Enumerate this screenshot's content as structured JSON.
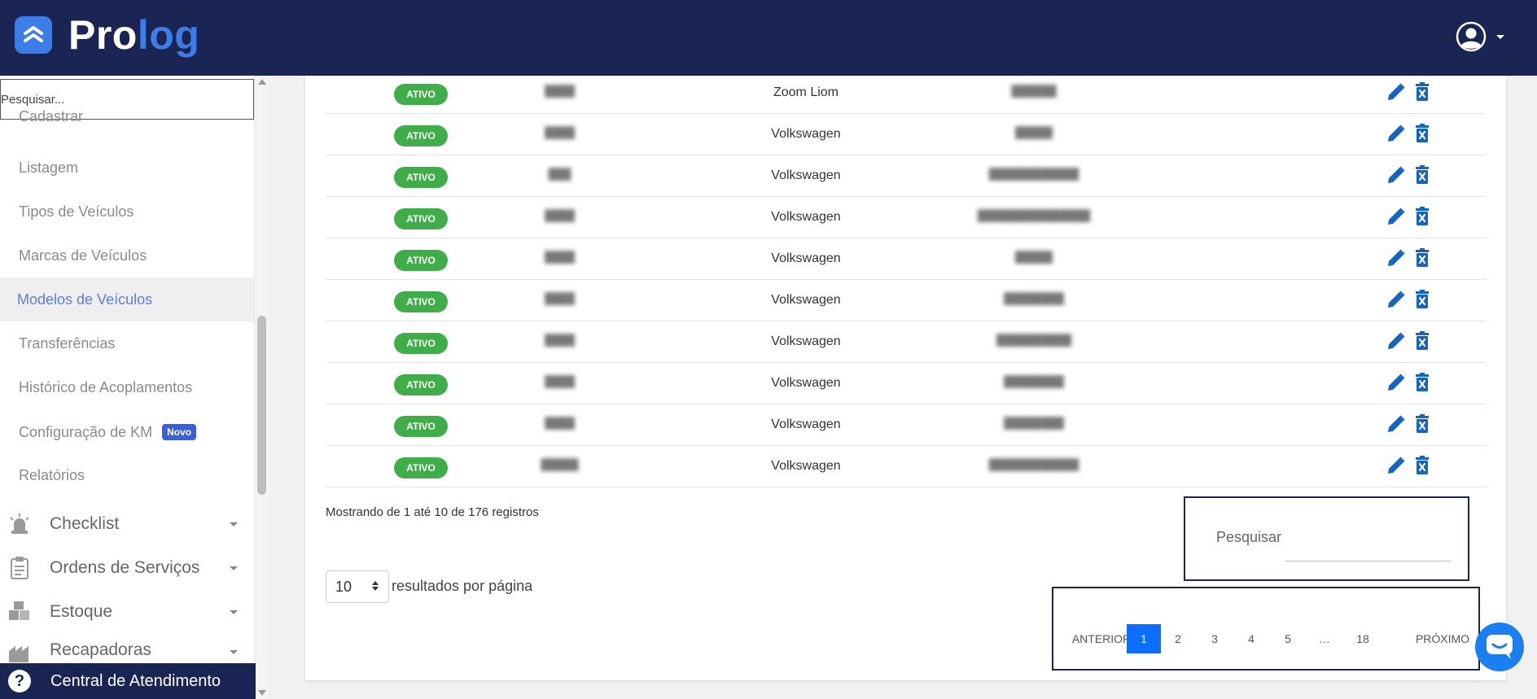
{
  "header": {
    "logo_part1": "Pro",
    "logo_part2": "log"
  },
  "sidebar": {
    "search_placeholder": "Pesquisar...",
    "items": [
      {
        "label": "Cadastrar"
      },
      {
        "label": "Listagem"
      },
      {
        "label": "Tipos de Veículos"
      },
      {
        "label": "Marcas de Veículos"
      },
      {
        "label": "Modelos de Veículos",
        "active": true
      },
      {
        "label": "Transferências"
      },
      {
        "label": "Histórico de Acoplamentos"
      },
      {
        "label": "Configuração de KM",
        "badge": "Novo"
      },
      {
        "label": "Relatórios"
      }
    ],
    "groups": [
      {
        "label": "Checklist",
        "icon": "siren-icon"
      },
      {
        "label": "Ordens de Serviços",
        "icon": "clipboard-icon"
      },
      {
        "label": "Estoque",
        "icon": "boxes-icon"
      },
      {
        "label": "Recapadoras",
        "icon": "factory-icon"
      }
    ],
    "central_label": "Central de Atendimento"
  },
  "table": {
    "rows": [
      {
        "status": "ATIVO",
        "plate": "████",
        "brand": "Zoom Liom",
        "model": "██████"
      },
      {
        "status": "ATIVO",
        "plate": "████",
        "brand": "Volkswagen",
        "model": "█████"
      },
      {
        "status": "ATIVO",
        "plate": "███",
        "brand": "Volkswagen",
        "model": "████████████"
      },
      {
        "status": "ATIVO",
        "plate": "████",
        "brand": "Volkswagen",
        "model": "███████████████"
      },
      {
        "status": "ATIVO",
        "plate": "████",
        "brand": "Volkswagen",
        "model": "█████"
      },
      {
        "status": "ATIVO",
        "plate": "████",
        "brand": "Volkswagen",
        "model": "████████"
      },
      {
        "status": "ATIVO",
        "plate": "████",
        "brand": "Volkswagen",
        "model": "██████████"
      },
      {
        "status": "ATIVO",
        "plate": "████",
        "brand": "Volkswagen",
        "model": "████████"
      },
      {
        "status": "ATIVO",
        "plate": "████",
        "brand": "Volkswagen",
        "model": "████████"
      },
      {
        "status": "ATIVO",
        "plate": "█████",
        "brand": "Volkswagen",
        "model": "████████████"
      }
    ],
    "info": "Mostrando de 1 até 10 de 176 registros",
    "page_length": "10",
    "page_length_label": "resultados por página",
    "search_label": "Pesquisar"
  },
  "pagination": {
    "prev": "ANTERIOR",
    "pages": [
      "1",
      "2",
      "3",
      "4",
      "5",
      "…",
      "18"
    ],
    "current": "1",
    "next": "PRÓXIMO"
  },
  "colors": {
    "navy": "#1b2554",
    "brand_blue": "#3d7de8",
    "status_green": "#3fae49",
    "action_blue": "#1565c0"
  }
}
